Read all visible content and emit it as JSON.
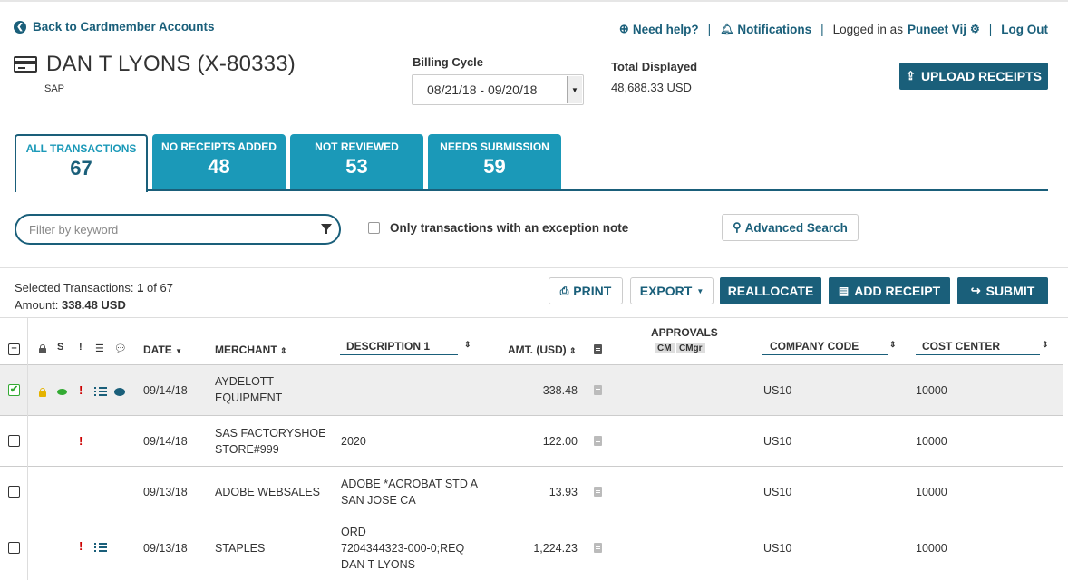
{
  "nav": {
    "back_label": "Back to Cardmember Accounts",
    "help_label": "Need help?",
    "notifications_label": "Notifications",
    "logged_in_prefix": "Logged in as",
    "user_name": "Puneet Vij",
    "logout_label": "Log Out"
  },
  "cardmember": {
    "name": "DAN T LYONS (X-80333)",
    "subtitle": "SAP"
  },
  "billing": {
    "label": "Billing Cycle",
    "selected": "08/21/18 - 09/20/18"
  },
  "total": {
    "label": "Total Displayed",
    "value": "48,688.33 USD"
  },
  "upload_label": "UPLOAD RECEIPTS",
  "tabs": [
    {
      "label": "ALL TRANSACTIONS",
      "count": "67"
    },
    {
      "label": "NO RECEIPTS ADDED",
      "count": "48"
    },
    {
      "label": "NOT REVIEWED",
      "count": "53"
    },
    {
      "label": "NEEDS SUBMISSION",
      "count": "59"
    }
  ],
  "filter": {
    "placeholder": "Filter by keyword",
    "exception_label": "Only transactions with an exception note",
    "advanced_label": "Advanced Search"
  },
  "selection": {
    "selected_label": "Selected Transactions:",
    "selected_count": "1",
    "selected_of": "of 67",
    "amount_label": "Amount:",
    "amount_value": "338.48 USD"
  },
  "actions": {
    "print": "PRINT",
    "export": "EXPORT",
    "reallocate": "REALLOCATE",
    "add_receipt": "ADD RECEIPT",
    "submit": "SUBMIT"
  },
  "table": {
    "headers": {
      "s": "S",
      "excl": "!",
      "date": "DATE",
      "merchant": "MERCHANT",
      "description": "DESCRIPTION 1",
      "amount": "AMT. (USD)",
      "approvals": "APPROVALS",
      "cm": "CM",
      "cmgr": "CMgr",
      "company_code": "COMPANY CODE",
      "cost_center": "COST CENTER"
    },
    "rows": [
      {
        "date": "09/14/18",
        "merchant_1": "AYDELOTT",
        "merchant_2": "EQUIPMENT",
        "desc_1": "",
        "desc_2": "",
        "desc_3": "",
        "amount": "338.48",
        "company_code": "US10",
        "cost_center": "10000"
      },
      {
        "date": "09/14/18",
        "merchant_1": "SAS FACTORYSHOE",
        "merchant_2": "STORE#999",
        "desc_1": "2020",
        "desc_2": "",
        "desc_3": "",
        "amount": "122.00",
        "company_code": "US10",
        "cost_center": "10000"
      },
      {
        "date": "09/13/18",
        "merchant_1": "ADOBE WEBSALES",
        "merchant_2": "",
        "desc_1": "ADOBE *ACROBAT STD A",
        "desc_2": "SAN JOSE CA",
        "desc_3": "",
        "amount": "13.93",
        "company_code": "US10",
        "cost_center": "10000"
      },
      {
        "date": "09/13/18",
        "merchant_1": "STAPLES",
        "merchant_2": "",
        "desc_1": "ORD",
        "desc_2": "7204344323-000-0;REQ",
        "desc_3": "DAN T LYONS",
        "amount": "1,224.23",
        "company_code": "US10",
        "cost_center": "10000"
      }
    ]
  }
}
